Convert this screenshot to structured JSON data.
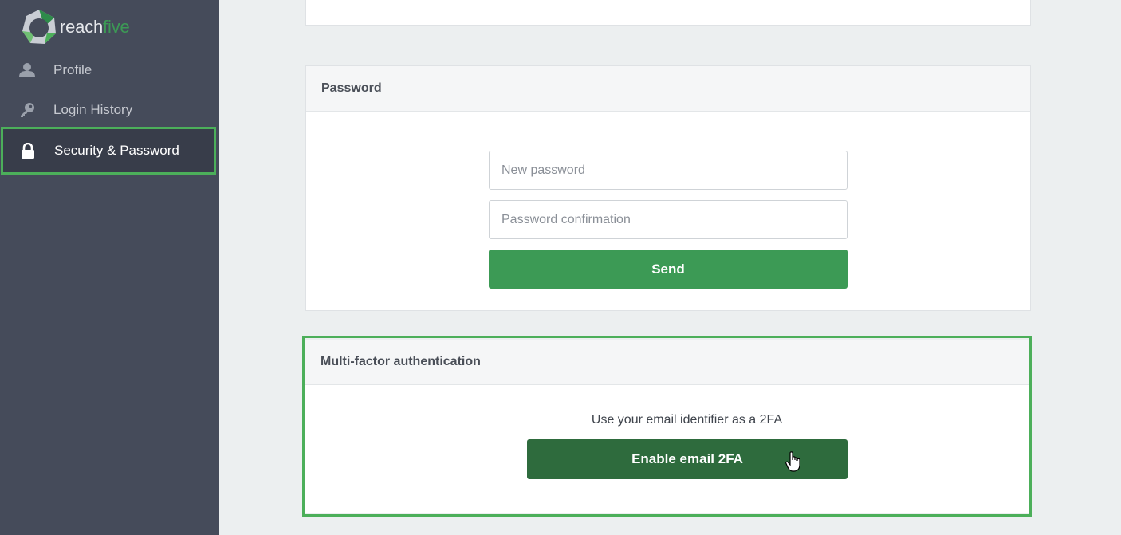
{
  "brand": {
    "word1": "reach",
    "word2": "five",
    "accent": "#3c9a55"
  },
  "sidebar": {
    "items": [
      {
        "label": "Profile",
        "icon": "user-icon",
        "active": false
      },
      {
        "label": "Login History",
        "icon": "key-icon",
        "active": false
      },
      {
        "label": "Security & Password",
        "icon": "lock-icon",
        "active": true
      }
    ]
  },
  "password_section": {
    "title": "Password",
    "new_password_placeholder": "New password",
    "confirmation_placeholder": "Password confirmation",
    "send_label": "Send",
    "button_color": "#3c9a55"
  },
  "mfa_section": {
    "title": "Multi-factor authentication",
    "description": "Use your email identifier as a 2FA",
    "enable_label": "Enable email 2FA",
    "button_color": "#2e6b3d",
    "highlight_color": "#4caf5a"
  }
}
